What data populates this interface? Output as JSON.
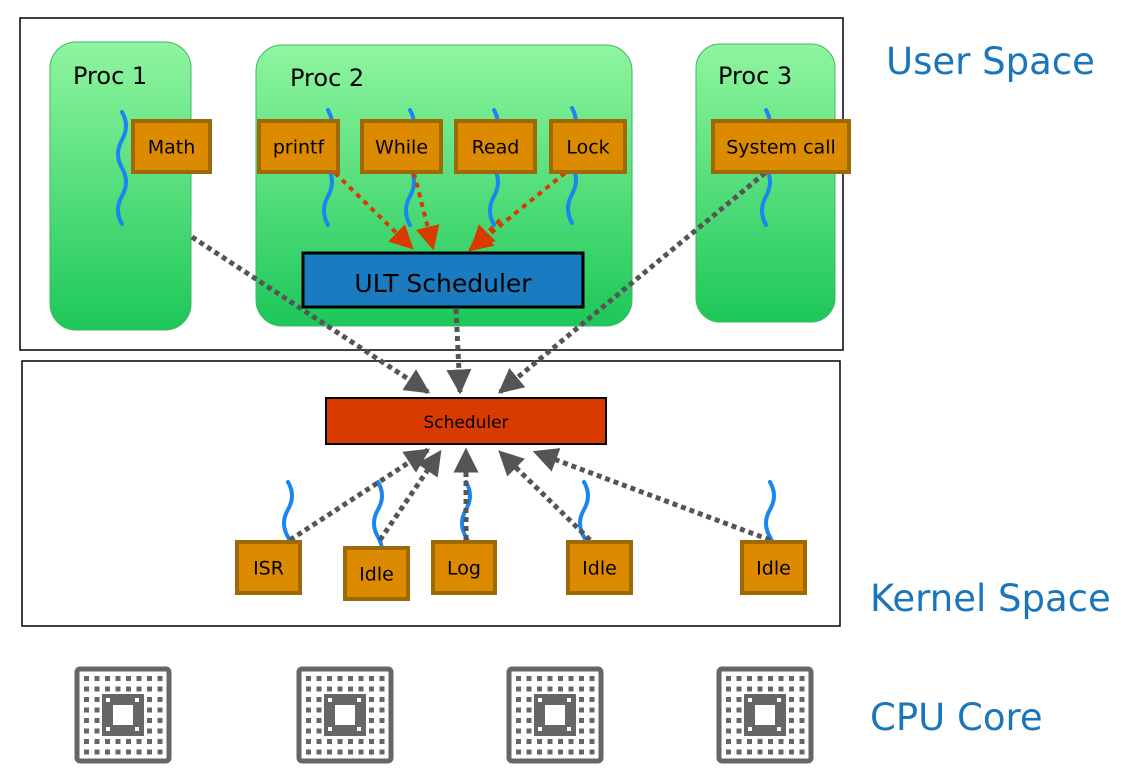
{
  "regions": {
    "user_space": "User Space",
    "kernel_space": "Kernel Space",
    "cpu_core": "CPU Core"
  },
  "processes": [
    {
      "name": "Proc 1",
      "threads": [
        "Math"
      ]
    },
    {
      "name": "Proc 2",
      "threads": [
        "printf",
        "While",
        "Read",
        "Lock"
      ]
    },
    {
      "name": "Proc 3",
      "threads": [
        "System call"
      ]
    }
  ],
  "ult_scheduler": "ULT Scheduler",
  "kernel_scheduler": "Scheduler",
  "kernel_threads": [
    "ISR",
    "Idle",
    "Log",
    "Idle",
    "Idle"
  ],
  "cpu_core_count": 4,
  "colors": {
    "label_blue": "#1b75bb",
    "process_green_top": "#90f5a0",
    "process_green_bottom": "#1dc75a",
    "thread_box": "#dc8b00",
    "thread_box_border": "#9e6a05",
    "ult_scheduler": "#1a7bc0",
    "kernel_scheduler": "#d93a00",
    "ult_arrow": "#d93a00",
    "kernel_arrow": "#555555",
    "thread_squiggle": "#1a86f0"
  }
}
